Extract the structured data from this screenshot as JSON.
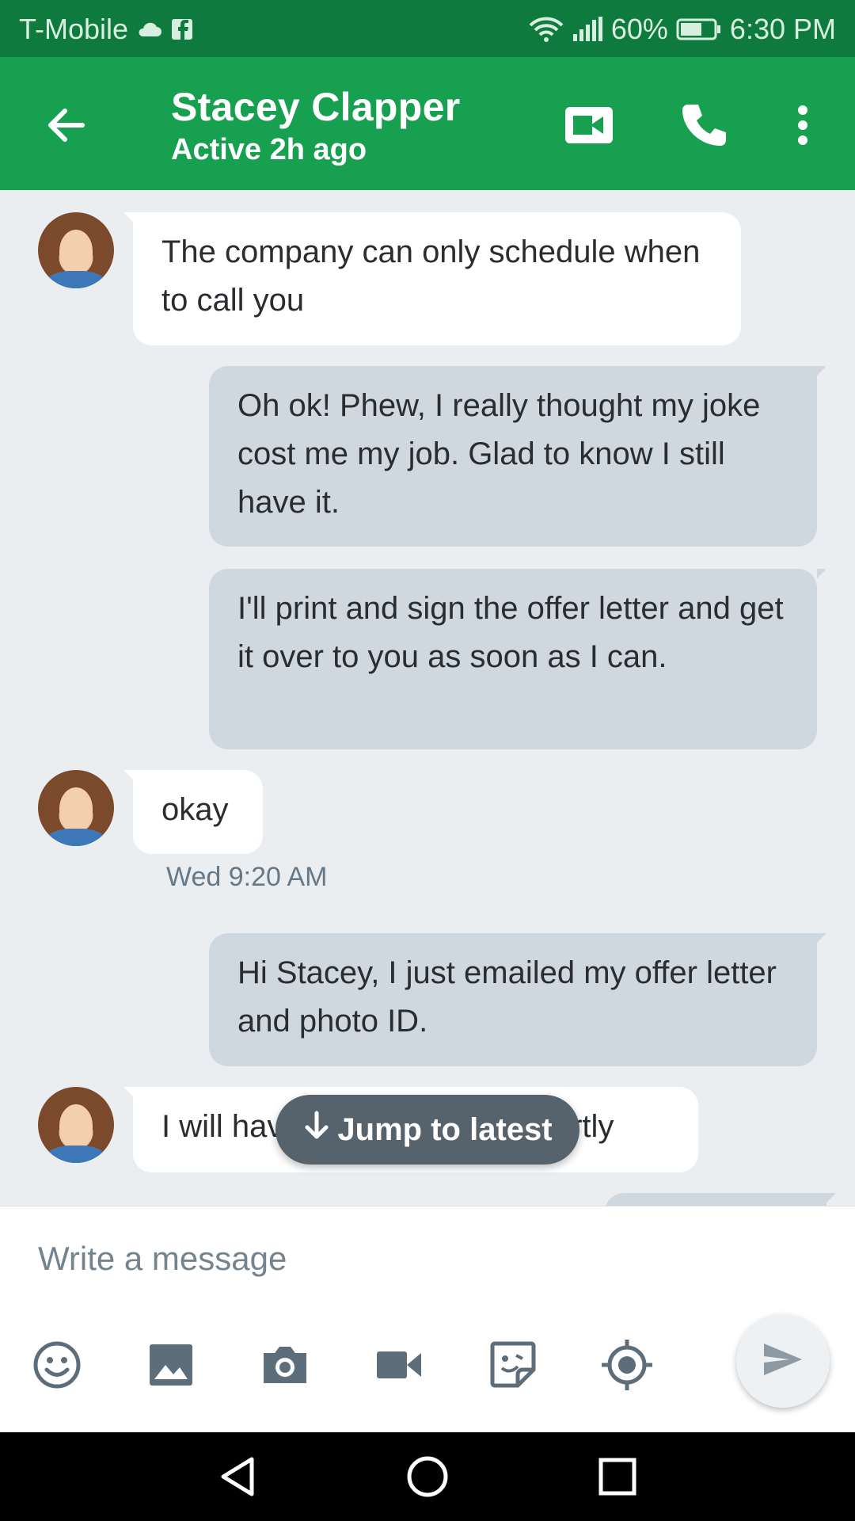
{
  "status_bar": {
    "carrier": "T-Mobile",
    "battery": "60%",
    "time": "6:30 PM",
    "icons": [
      "cloud-icon",
      "facebook-icon",
      "wifi-icon",
      "signal-icon",
      "battery-icon"
    ]
  },
  "header": {
    "title": "Stacey Clapper",
    "subtitle": "Active 2h ago",
    "actions": [
      "back-arrow-icon",
      "video-call-icon",
      "phone-icon",
      "more-vert-icon"
    ]
  },
  "messages": [
    {
      "direction": "in",
      "text": "The company can only schedule when to call you"
    },
    {
      "direction": "out",
      "text": "Oh ok! Phew, I really thought my joke cost me my job. Glad to know I still have it."
    },
    {
      "direction": "out",
      "text": "I'll print and sign the offer letter and get it over to you as soon as I can."
    },
    {
      "direction": "in",
      "text": "okay"
    },
    {
      "direction": "out",
      "text": "Hi Stacey, I just emailed my offer letter and photo ID."
    },
    {
      "direction": "in",
      "text": "I will have update for you shortly"
    }
  ],
  "timestamp": "Wed 9:20 AM",
  "jump_to_latest": "Jump to latest",
  "compose": {
    "placeholder": "Write a message",
    "tools": [
      "emoji-icon",
      "image-icon",
      "camera-icon",
      "video-icon",
      "sticker-icon",
      "location-icon"
    ],
    "send_icon": "send-icon"
  },
  "colors": {
    "status_bar": "#0f7a3d",
    "app_bar": "#16a050",
    "incoming_bubble": "#ffffff",
    "outgoing_bubble": "#cfd7df",
    "background": "#ebeef1",
    "jump_pill": "#56636c",
    "icon_gray": "#5d6e7a"
  }
}
